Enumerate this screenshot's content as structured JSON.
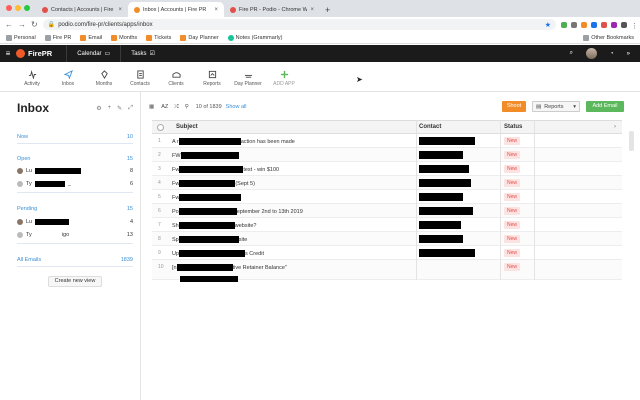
{
  "browser": {
    "tabs": [
      {
        "label": "Contacts | Accounts | Fire PR",
        "active": false,
        "favicon_color": "#e2504a"
      },
      {
        "label": "Inbox | Accounts | Fire PR",
        "active": true,
        "favicon_color": "#f28c28"
      },
      {
        "label": "Fire PR - Podio - Chrome Web",
        "active": false,
        "favicon_color": "#e2504a"
      }
    ],
    "new_tab": "+",
    "url": "podio.com/fire-pr/clients/apps/inbox",
    "bookmarks": [
      "Personal",
      "Fire PR",
      "Email",
      "Months",
      "Tickets",
      "Day Planner",
      "Notes (Grammarly)"
    ],
    "other_bookmarks": "Other Bookmarks"
  },
  "header": {
    "brand": "FirePR",
    "calendar": "Calendar",
    "tasks": "Tasks"
  },
  "apps": [
    {
      "label": "Activity",
      "icon": "activity-icon"
    },
    {
      "label": "Inbox",
      "icon": "paper-plane-icon"
    },
    {
      "label": "Months",
      "icon": "months-icon"
    },
    {
      "label": "Contacts",
      "icon": "contacts-icon"
    },
    {
      "label": "Clients",
      "icon": "clients-icon"
    },
    {
      "label": "Reports",
      "icon": "reports-icon"
    },
    {
      "label": "Day Planner",
      "icon": "day-planner-icon"
    },
    {
      "label": "ADD APP",
      "icon": "plus-icon"
    }
  ],
  "panel": {
    "title": "Inbox",
    "views": {
      "now": {
        "label": "Now",
        "count": "10"
      },
      "open": {
        "label": "Open",
        "count": "15",
        "people": [
          {
            "prefix": "Lu",
            "count": "8"
          },
          {
            "prefix": "Ty",
            "suffix": "_",
            "count": "6"
          }
        ]
      },
      "pending": {
        "label": "Pending",
        "count": "15",
        "people": [
          {
            "prefix": "Lu",
            "count": "4"
          },
          {
            "prefix": "Ty",
            "suffix": "igo",
            "count": "13"
          }
        ]
      },
      "all": {
        "label": "All Emails",
        "count": "1839"
      }
    },
    "create_view": "Create new view"
  },
  "toolbar": {
    "sort": "AZ",
    "count": "10 of 1839",
    "show_all": "Show all",
    "shoot": "Shoot",
    "reports": "Reports",
    "add": "Add Email"
  },
  "table": {
    "headers": [
      "Subject",
      "Contact",
      "Status"
    ],
    "rows": [
      {
        "num": "1",
        "pre": "A r",
        "post": "action has been made",
        "status": "New"
      },
      {
        "num": "2",
        "pre": "FW",
        "post": "",
        "status": "New"
      },
      {
        "num": "3",
        "pre": "Fw",
        "post": "test - win $100",
        "status": "New"
      },
      {
        "num": "4",
        "pre": "Fw",
        "post": "(Sept 5)",
        "status": "New"
      },
      {
        "num": "5",
        "pre": "Fw",
        "post": "",
        "status": "New"
      },
      {
        "num": "6",
        "pre": "Po",
        "post": "eptember 2nd to 13th 2019",
        "status": "New"
      },
      {
        "num": "7",
        "pre": "Sh",
        "post": "website?",
        "status": "New"
      },
      {
        "num": "8",
        "pre": "Sp",
        "post": "site",
        "status": "New"
      },
      {
        "num": "9",
        "pre": "Up",
        "post": "s Credit",
        "status": "New"
      },
      {
        "num": "10",
        "pre": "[n",
        "post": "tive Retainer Balance\"",
        "status": "New"
      }
    ]
  }
}
